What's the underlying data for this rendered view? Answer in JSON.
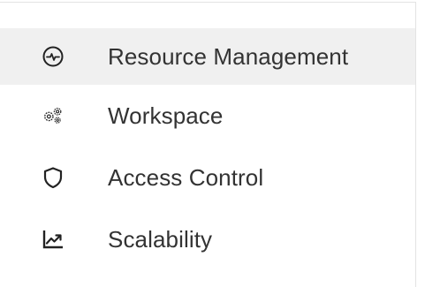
{
  "menu": {
    "items": [
      {
        "label": "Resource Management",
        "icon": "gauge-icon",
        "active": true
      },
      {
        "label": "Workspace",
        "icon": "gears-icon",
        "active": false
      },
      {
        "label": "Access Control",
        "icon": "shield-icon",
        "active": false
      },
      {
        "label": "Scalability",
        "icon": "trending-chart-icon",
        "active": false
      }
    ]
  },
  "colors": {
    "text": "#333333",
    "icon": "#222222",
    "active_background": "#f0f0f0",
    "border": "#e3e3e3"
  }
}
